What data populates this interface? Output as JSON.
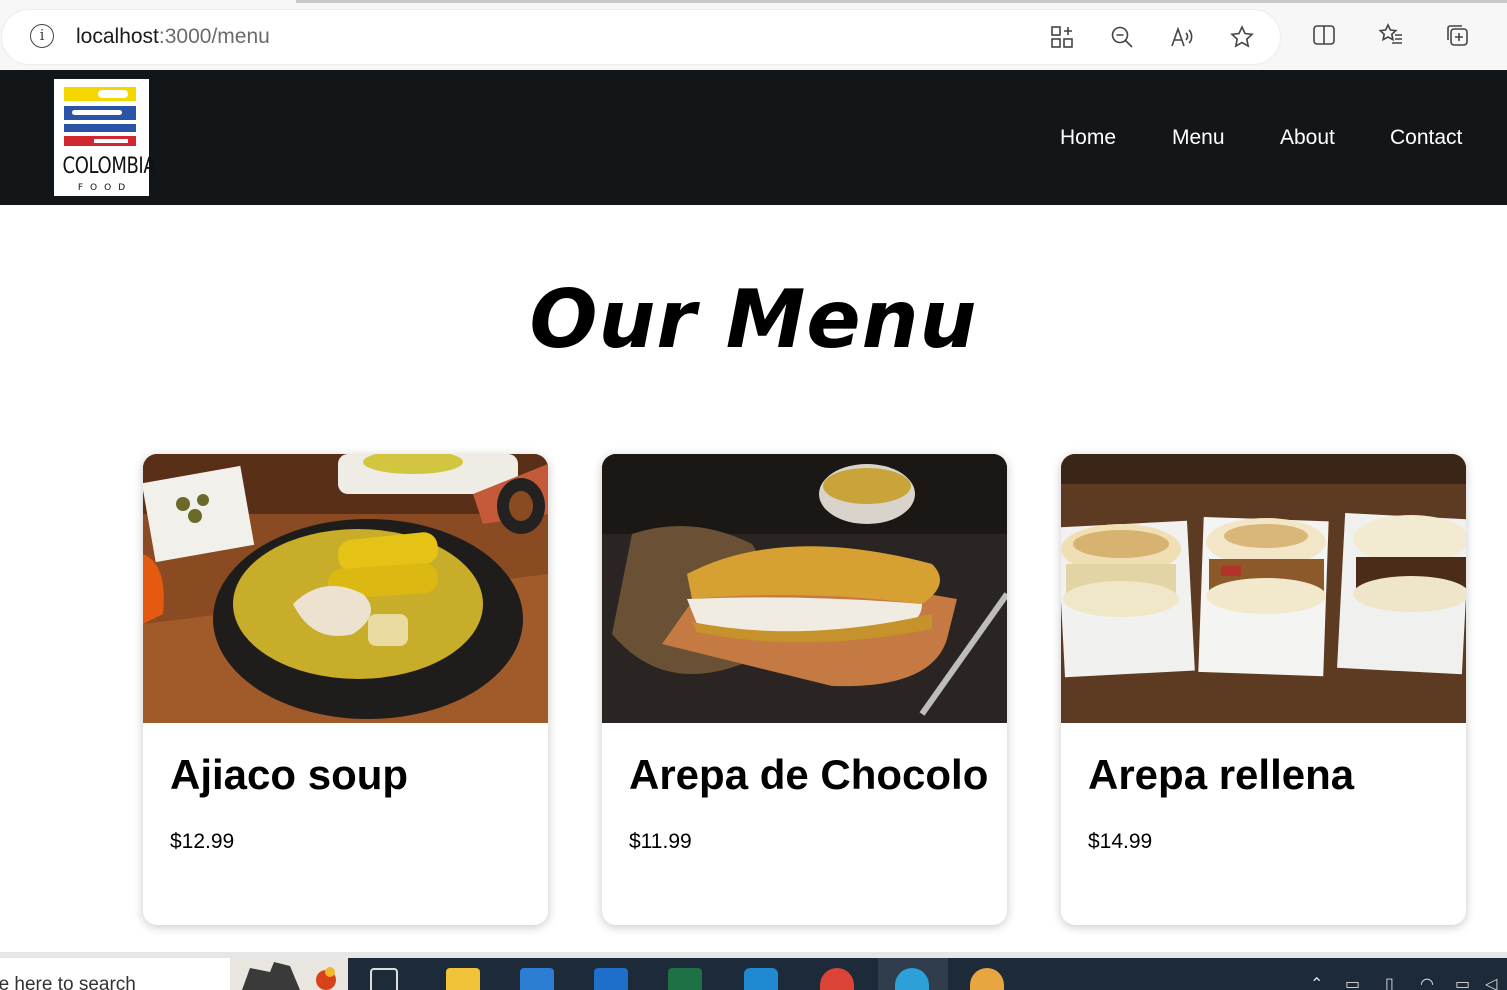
{
  "browser": {
    "url_host": "localhost",
    "url_path": ":3000/menu",
    "icons": [
      "info-icon",
      "app-available-icon",
      "zoom-out-icon",
      "read-aloud-icon",
      "favorite-star-icon",
      "split-screen-icon",
      "favorites-icon",
      "collections-icon"
    ]
  },
  "site": {
    "logo_text": "COLOMBIA",
    "logo_sub": "FOOD",
    "nav": [
      "Home",
      "Menu",
      "About",
      "Contact"
    ]
  },
  "main": {
    "title": "Our Menu",
    "items": [
      {
        "name": "Ajiaco soup",
        "price": "$12.99"
      },
      {
        "name": "Arepa de Chocolo",
        "price": "$11.99"
      },
      {
        "name": "Arepa rellena",
        "price": "$14.99"
      }
    ]
  },
  "taskbar": {
    "search_placeholder": "pe here to search",
    "apps": [
      "task-view-icon",
      "file-explorer-icon",
      "store-icon",
      "mail-icon",
      "excel-icon",
      "vscode-icon",
      "chrome-icon",
      "edge-icon",
      "paint-icon"
    ]
  },
  "colors": {
    "header_bg": "#131619",
    "flag_yellow": "#f5d700",
    "flag_blue": "#2a54a8",
    "flag_red": "#d0262f"
  }
}
